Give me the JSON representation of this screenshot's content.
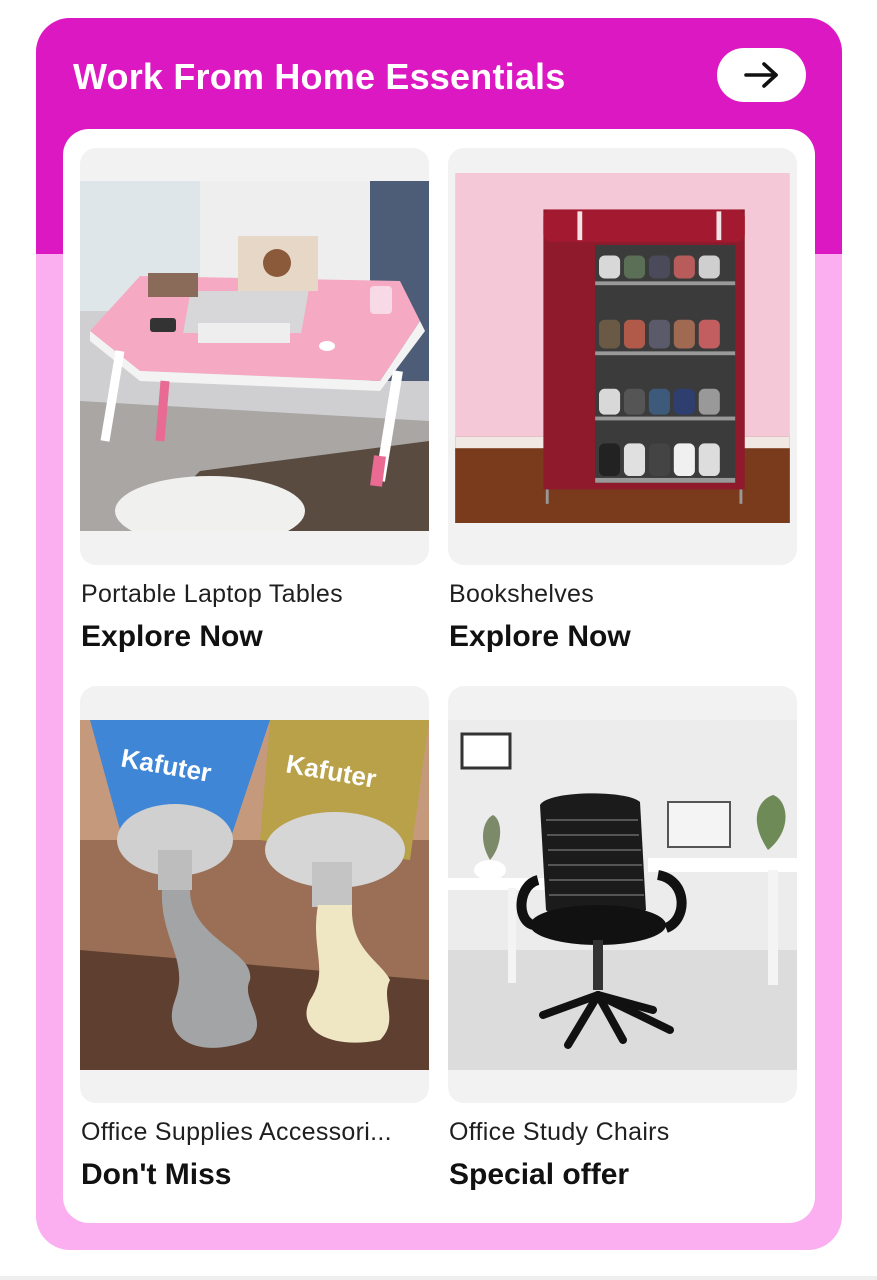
{
  "header": {
    "title": "Work From Home Essentials",
    "arrow_icon": "arrow-right-icon"
  },
  "tiles": [
    {
      "name": "Portable Laptop Tables",
      "cta": "Explore Now",
      "image": "pink-laptop-table-photo"
    },
    {
      "name": "Bookshelves",
      "cta": "Explore Now",
      "image": "red-shoe-rack-photo"
    },
    {
      "name": "Office Supplies Accessori...",
      "cta": "Don't Miss",
      "image": "glue-tubes-photo"
    },
    {
      "name": "Office Study Chairs",
      "cta": "Special offer",
      "image": "office-chair-photo"
    }
  ],
  "colors": {
    "header_bg": "#dc18c2",
    "card_bg": "#fbaff0",
    "tile_bg": "#f2f2f2",
    "text": "#111111"
  }
}
